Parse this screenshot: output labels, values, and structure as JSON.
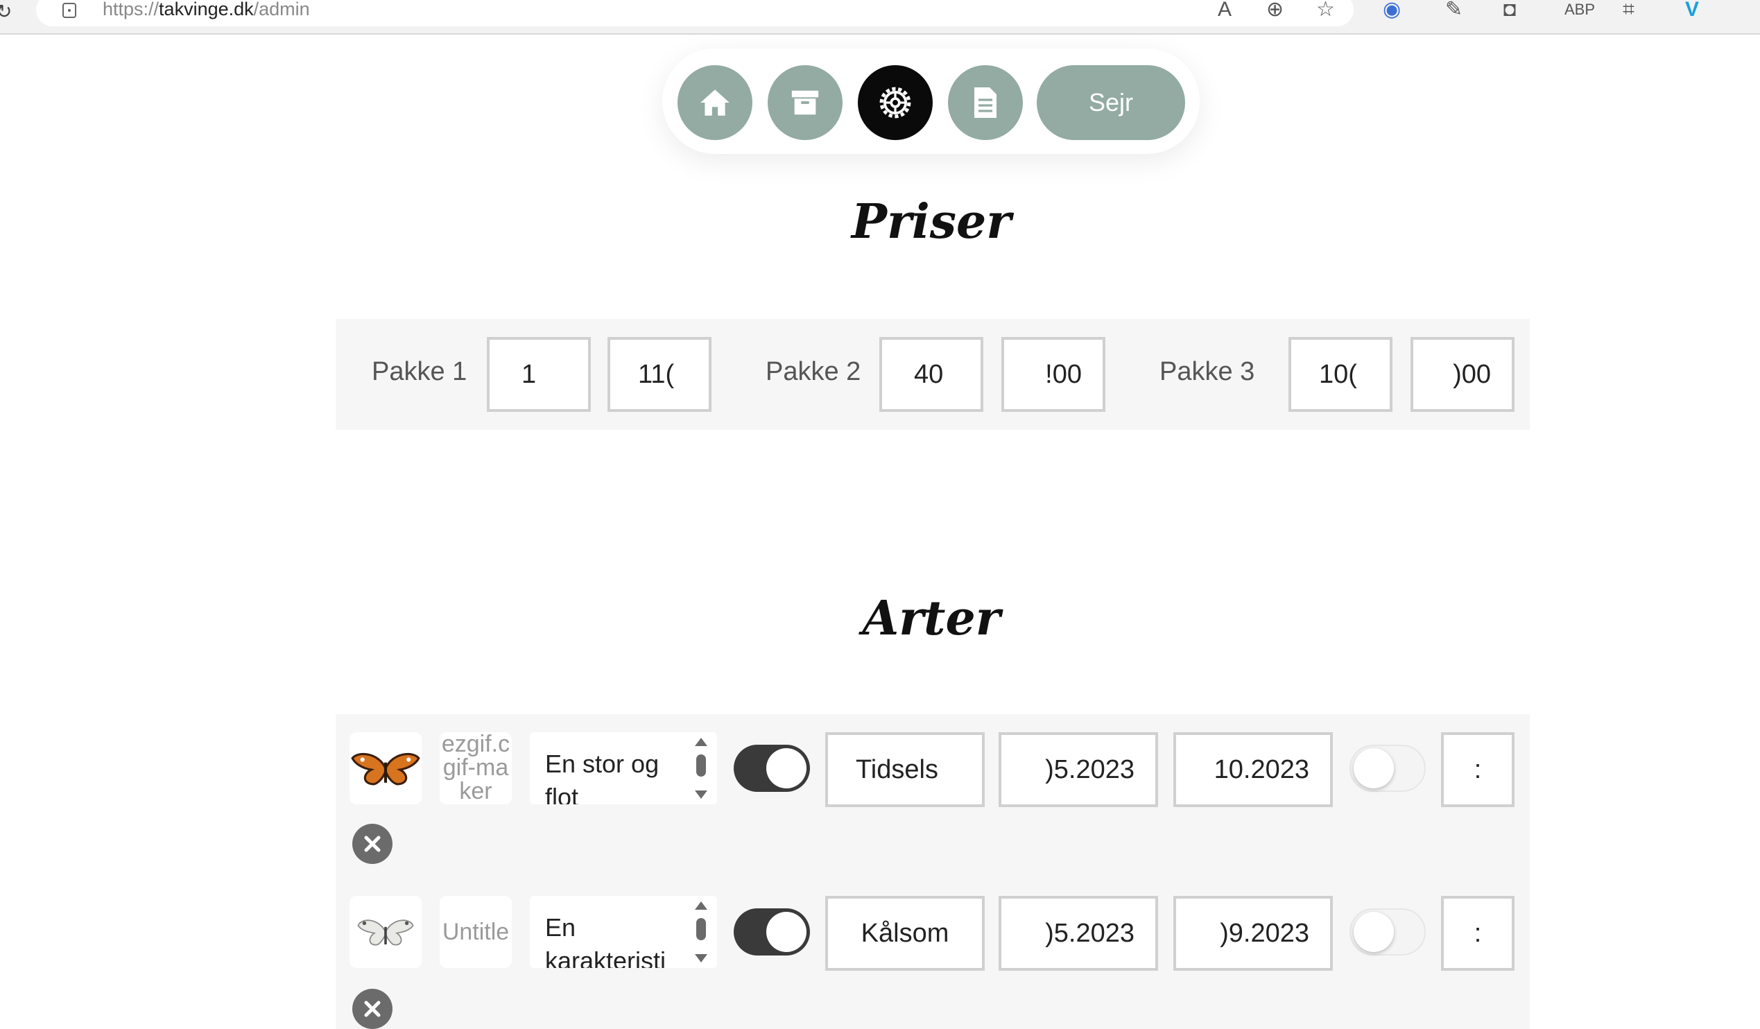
{
  "browser": {
    "url_prefix": "https://",
    "url_host": "takvinge.dk",
    "url_path": "/admin",
    "toolbar_icons": [
      "read-aloud-icon",
      "zoom-icon",
      "favorites-icon",
      "password-icon",
      "extension-icon",
      "screenshot-icon",
      "adblock-icon",
      "crop-icon",
      "vimeo-icon"
    ]
  },
  "nav": {
    "items": [
      {
        "name": "home",
        "icon": "home-icon"
      },
      {
        "name": "archive",
        "icon": "archive-icon"
      },
      {
        "name": "settings",
        "icon": "gear-icon",
        "active": true
      },
      {
        "name": "document",
        "icon": "document-icon"
      }
    ],
    "sejr_label": "Sejr",
    "colors": {
      "button": "#93aba2",
      "active": "#0a0a0a"
    }
  },
  "prices": {
    "title": "Priser",
    "packages": [
      {
        "label": "Pakke 1",
        "field1": "1",
        "field2": "11("
      },
      {
        "label": "Pakke 2",
        "field1": "40",
        "field2": "!00"
      },
      {
        "label": "Pakke 3",
        "field1": "10(",
        "field2": ")00"
      }
    ]
  },
  "species": {
    "title": "Arter",
    "rows": [
      {
        "thumb_icon": "painted-lady-butterfly-icon",
        "filename": "ezgif.c gif-maker",
        "description": "En stor og flot",
        "active": true,
        "name": "Tidsels",
        "start": ")5.2023",
        "end": "10.2023",
        "flag": false,
        "extra": ":"
      },
      {
        "thumb_icon": "white-butterfly-icon",
        "filename": "Untitle",
        "description": "En karakteristi",
        "active": true,
        "name": "Kålsom",
        "start": ")5.2023",
        "end": ")9.2023",
        "flag": false,
        "extra": ":"
      }
    ]
  }
}
